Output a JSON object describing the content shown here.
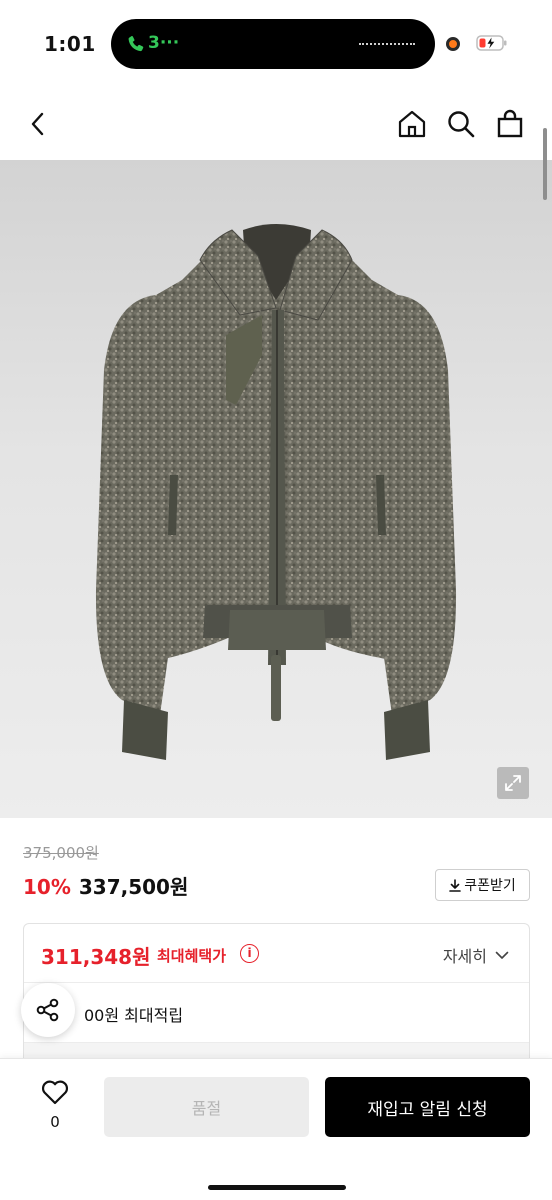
{
  "status_bar": {
    "time": "1:01",
    "call_label": "3···",
    "call_color": "#34c759",
    "icons": [
      "phone-icon",
      "recording-dot-icon",
      "battery-charging-icon"
    ]
  },
  "nav": {
    "icons": [
      "back-chevron-icon",
      "home-icon",
      "search-icon",
      "shopping-bag-icon"
    ]
  },
  "product": {
    "image_desc_icon": "jacket-image",
    "expand_icon": "expand-icon"
  },
  "price": {
    "original": "375,000원",
    "discount": "10%",
    "sale": "337,500원",
    "coupon_label": "쿠폰받기",
    "accent_color": "#e6212b"
  },
  "benefit": {
    "max_price": "311,348원",
    "max_label": "최대혜택가",
    "info_glyph": "i",
    "detail_label": "자세히",
    "points_text": "00원 최대적립"
  },
  "bottom_bar": {
    "wish_count": "0",
    "soldout_label": "품절",
    "notify_label": "재입고 알림 신청"
  }
}
